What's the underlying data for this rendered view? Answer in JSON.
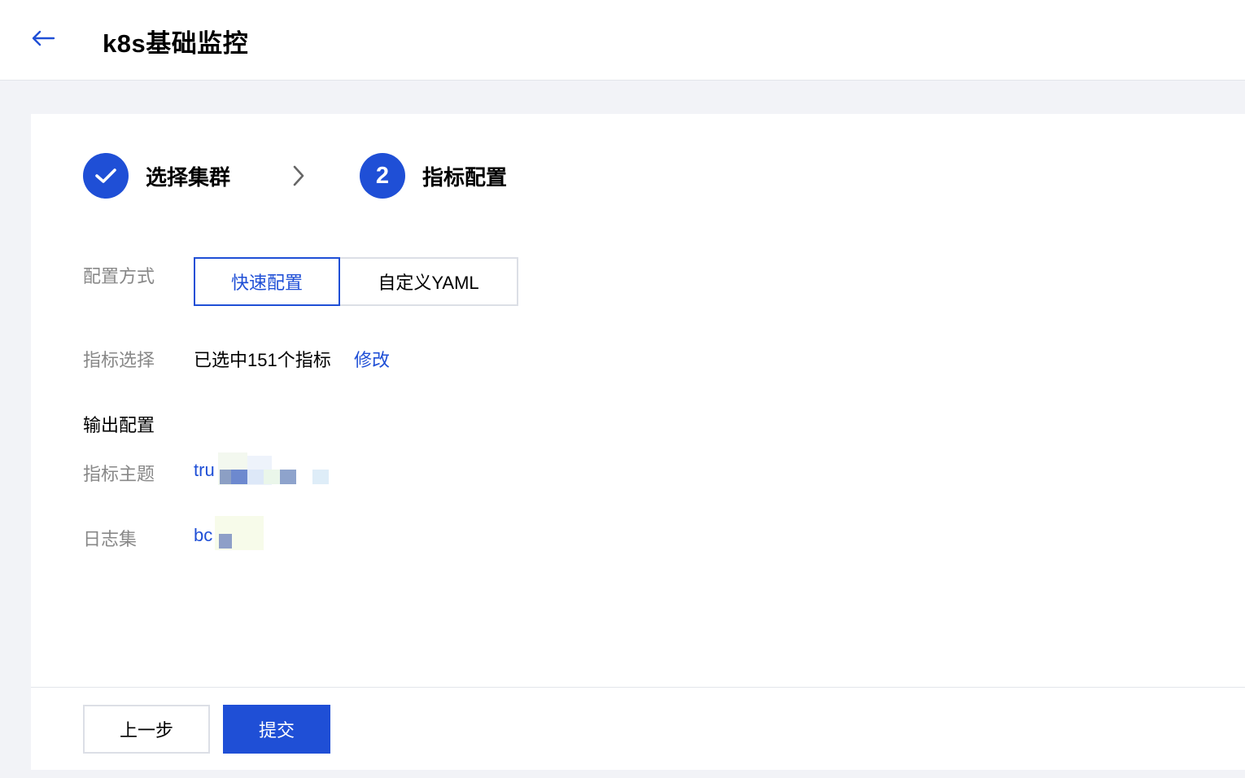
{
  "header": {
    "title": "k8s基础监控"
  },
  "steps": [
    {
      "label": "选择集群",
      "state": "done"
    },
    {
      "number": "2",
      "label": "指标配置",
      "state": "active"
    }
  ],
  "form": {
    "config_mode": {
      "label": "配置方式",
      "options": [
        "快速配置",
        "自定义YAML"
      ],
      "selected": "快速配置"
    },
    "metrics": {
      "label": "指标选择",
      "value": "已选中151个指标",
      "action": "修改"
    },
    "output_section_title": "输出配置",
    "metric_topic": {
      "label": "指标主题",
      "value": "tru"
    },
    "logset": {
      "label": "日志集",
      "value": "bc"
    }
  },
  "footer": {
    "prev_label": "上一步",
    "submit_label": "提交"
  },
  "colors": {
    "primary": "#1f4fd6",
    "background": "#f2f3f7",
    "label_gray": "#888888"
  }
}
